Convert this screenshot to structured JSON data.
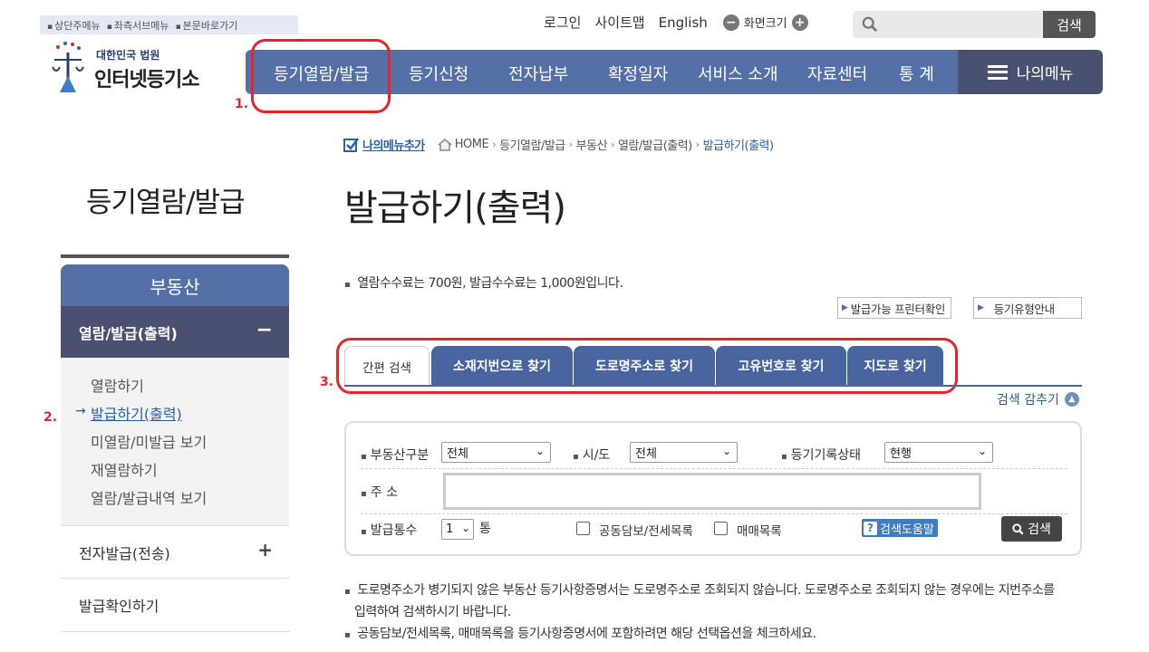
{
  "skip_links": [
    "상단주메뉴",
    "좌측서브메뉴",
    "본문바로가기"
  ],
  "util": {
    "login": "로그인",
    "sitemap": "사이트맵",
    "english": "English",
    "zoom_label": "화면크기",
    "zoom_minus": "−",
    "zoom_plus": "+",
    "search_placeholder": "",
    "search_button": "검색"
  },
  "logo": {
    "line1": "대한민국 법원",
    "line2": "인터넷등기소"
  },
  "gnb": {
    "items": [
      "등기열람/발급",
      "등기신청",
      "전자납부",
      "확정일자",
      "서비스 소개",
      "자료센터",
      "통 계"
    ],
    "mymenu": "나의메뉴"
  },
  "annotations": [
    "1.",
    "2.",
    "3."
  ],
  "breadcrumb": {
    "add_menu": "나의메뉴추가",
    "home": "HOME",
    "items": [
      "등기열람/발급",
      "부동산",
      "열람/발급(출력)"
    ],
    "current": "발급하기(출력)"
  },
  "lnb": {
    "title": "등기열람/발급",
    "head": "부동산",
    "selected": "열람/발급(출력)",
    "selected_toggle": "−",
    "sub_items": [
      "열람하기",
      "발급하기(출력)",
      "미열람/미발급 보기",
      "재열람하기",
      "열람/발급내역 보기"
    ],
    "active_arrow": "→",
    "items": [
      {
        "label": "전자발급(전송)",
        "toggle": "+"
      },
      {
        "label": "발급확인하기",
        "toggle": ""
      }
    ]
  },
  "page": {
    "title": "발급하기(출력)",
    "fee_notice": "열람수수료는 700원, 발급수수료는 1,000원입니다.",
    "btn_printer": "발급가능 프린터확인",
    "btn_type": "등기유형안내"
  },
  "tabs": [
    "간편 검색",
    "소재지번으로 찾기",
    "도로명주소로 찾기",
    "고유번호로 찾기",
    "지도로 찾기"
  ],
  "hide_search": "검색 감추기",
  "form": {
    "label_type": "부동산구분",
    "value_type": "전체",
    "label_city": "시/도",
    "value_city": "전체",
    "label_status": "등기기록상태",
    "value_status": "현행",
    "label_address": "주 소",
    "address_value": "",
    "label_count": "발급통수",
    "value_count": "1",
    "count_unit": "통",
    "chk_joint": "공동담보/전세목록",
    "chk_trade": "매매목록",
    "help": "검색도움말",
    "search": "검색"
  },
  "notes": [
    "도로명주소가 병기되지 않은 부동산 등기사항증명서는 도로명주소로 조회되지 않습니다. 도로명주소로 조회되지 않는 경우에는 지번주소를",
    "입력하여 검색하시기 바랍니다.",
    "공동담보/전세목록, 매매목록을 등기사항증명서에 포함하려면 해당 선택옵션을 체크하세요."
  ],
  "colors": {
    "primary": "#5570a6",
    "dark": "#4a5070",
    "annotation": "#e3262d"
  }
}
